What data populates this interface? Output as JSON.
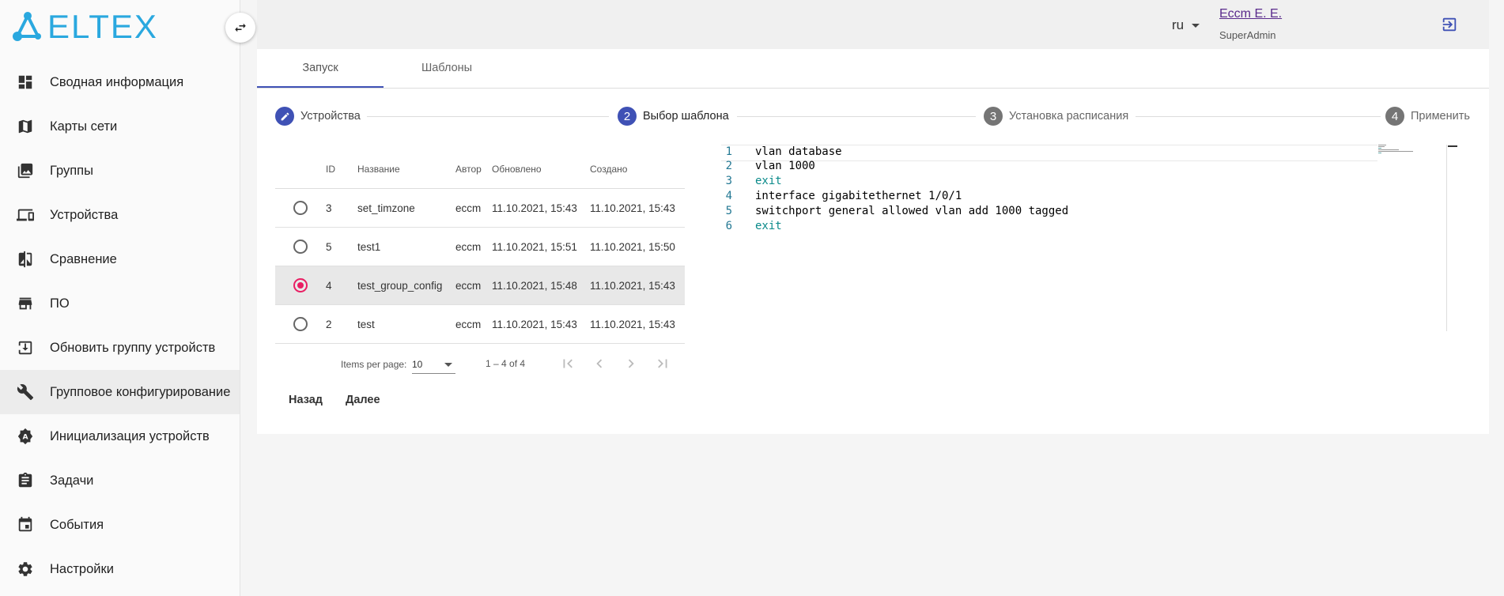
{
  "brand": {
    "logo_text": "ELTEX",
    "accent": "#2aa8df"
  },
  "sidebar": {
    "items": [
      {
        "label": "Сводная информация",
        "icon": "dashboard-icon"
      },
      {
        "label": "Карты сети",
        "icon": "map-icon"
      },
      {
        "label": "Группы",
        "icon": "photo-library-icon"
      },
      {
        "label": "Устройства",
        "icon": "devices-icon"
      },
      {
        "label": "Сравнение",
        "icon": "compare-icon"
      },
      {
        "label": "ПО",
        "icon": "store-icon"
      },
      {
        "label": "Обновить группу устройств",
        "icon": "download-icon"
      },
      {
        "label": "Групповое конфигурирование",
        "icon": "wrench-icon",
        "active": true
      },
      {
        "label": "Инициализация устройств",
        "icon": "gear-a-icon"
      },
      {
        "label": "Задачи",
        "icon": "clipboard-icon"
      },
      {
        "label": "События",
        "icon": "calendar-icon"
      },
      {
        "label": "Настройки",
        "icon": "settings-icon"
      }
    ]
  },
  "header": {
    "language": "ru",
    "user_name": "Eccm E. E.",
    "user_role": "SuperAdmin"
  },
  "tabs": [
    {
      "label": "Запуск",
      "active": true
    },
    {
      "label": "Шаблоны",
      "active": false
    }
  ],
  "stepper": {
    "steps": [
      {
        "number": "",
        "label": "Устройства",
        "state": "done"
      },
      {
        "number": "2",
        "label": "Выбор шаблона",
        "state": "active"
      },
      {
        "number": "3",
        "label": "Установка расписания",
        "state": "pending"
      },
      {
        "number": "4",
        "label": "Применить",
        "state": "pending"
      }
    ]
  },
  "table": {
    "columns": [
      "ID",
      "Название",
      "Автор",
      "Обновлено",
      "Создано"
    ],
    "rows": [
      {
        "id": "3",
        "name": "set_timzone",
        "author": "eccm",
        "updated": "11.10.2021, 15:43",
        "created": "11.10.2021, 15:43",
        "selected": false
      },
      {
        "id": "5",
        "name": "test1",
        "author": "eccm",
        "updated": "11.10.2021, 15:51",
        "created": "11.10.2021, 15:50",
        "selected": false
      },
      {
        "id": "4",
        "name": "test_group_config",
        "author": "eccm",
        "updated": "11.10.2021, 15:48",
        "created": "11.10.2021, 15:43",
        "selected": true
      },
      {
        "id": "2",
        "name": "test",
        "author": "eccm",
        "updated": "11.10.2021, 15:43",
        "created": "11.10.2021, 15:43",
        "selected": false
      }
    ]
  },
  "paginator": {
    "items_per_page_label": "Items per page:",
    "page_size": "10",
    "range": "1 – 4 of 4"
  },
  "actions": {
    "back": "Назад",
    "next": "Далее"
  },
  "editor": {
    "lines": [
      {
        "n": "1",
        "text": "vlan database",
        "kw": false
      },
      {
        "n": "2",
        "text": "vlan 1000",
        "kw": false
      },
      {
        "n": "3",
        "text": "exit",
        "kw": true
      },
      {
        "n": "4",
        "text": "interface gigabitethernet 1/0/1",
        "kw": false
      },
      {
        "n": "5",
        "text": "switchport general allowed vlan add 1000 tagged",
        "kw": false
      },
      {
        "n": "6",
        "text": "exit",
        "kw": true
      }
    ]
  },
  "colors": {
    "primary": "#3f51b5",
    "radio_selected": "#e91e63",
    "step_pending": "#757575"
  }
}
